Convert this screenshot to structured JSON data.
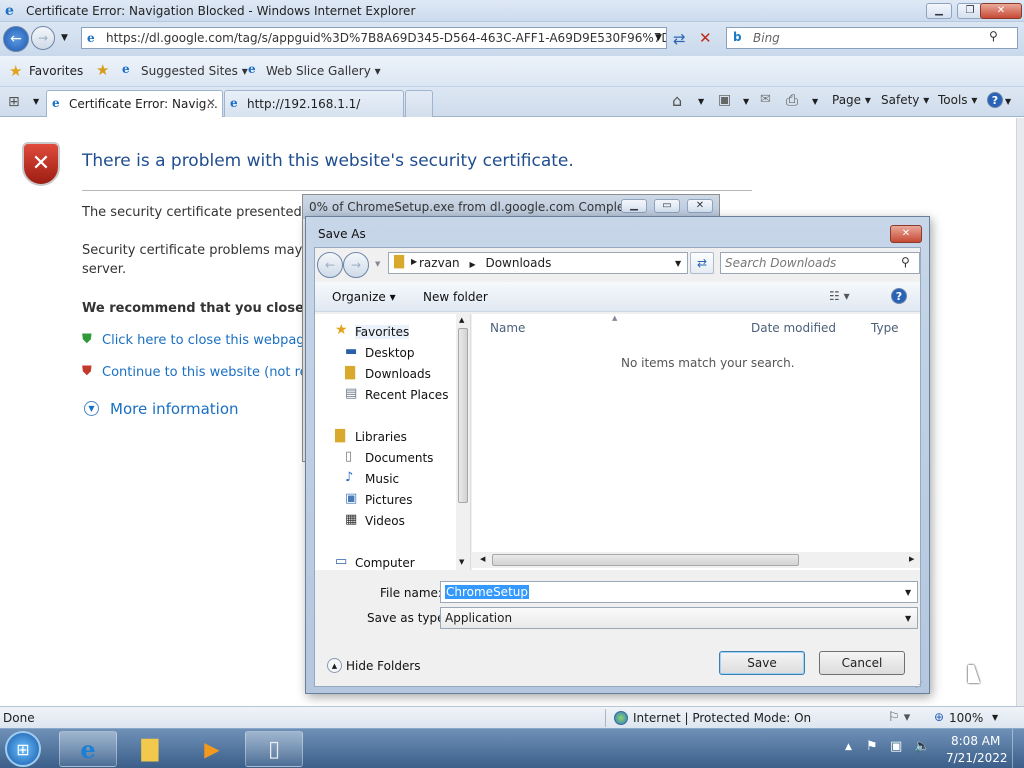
{
  "window": {
    "title": "Certificate Error: Navigation Blocked - Windows Internet Explorer"
  },
  "address": {
    "url": "https://dl.google.com/tag/s/appguid%3D%7B8A69D345-D564-463C-AFF1-A69D9E530F96%7D%26iid%",
    "search_placeholder": "Bing"
  },
  "favbar": {
    "favorites": "Favorites",
    "suggested": "Suggested Sites",
    "webslice": "Web Slice Gallery"
  },
  "tabs": [
    {
      "label": "Certificate Error: Navig..."
    },
    {
      "label": "http://192.168.1.1/"
    }
  ],
  "cmdbar": {
    "page": "Page",
    "safety": "Safety",
    "tools": "Tools"
  },
  "content": {
    "heading": "There is a problem with this website's security certificate.",
    "p1": "The security certificate presented by",
    "p2a": "Security certificate problems may ind",
    "p2b": "server.",
    "recommend": "We recommend that you close th",
    "close_link": "Click here to close this webpage.",
    "continue_link": "Continue to this website (not rec",
    "more_info": "More information"
  },
  "download": {
    "title": "0% of ChromeSetup.exe from dl.google.com Completed"
  },
  "dialog": {
    "title": "Save As",
    "breadcrumb": [
      "razvan",
      "Downloads"
    ],
    "search_placeholder": "Search Downloads",
    "organize": "Organize",
    "new_folder": "New folder",
    "nav_favorites": "Favorites",
    "nav_items": [
      "Desktop",
      "Downloads",
      "Recent Places"
    ],
    "nav_libraries": "Libraries",
    "lib_items": [
      "Documents",
      "Music",
      "Pictures",
      "Videos"
    ],
    "nav_computer": "Computer",
    "columns": {
      "name": "Name",
      "date": "Date modified",
      "type": "Type"
    },
    "empty": "No items match your search.",
    "filename_label": "File name:",
    "filename": "ChromeSetup",
    "savetype_label": "Save as type:",
    "savetype": "Application",
    "hide_folders": "Hide Folders",
    "save": "Save",
    "cancel": "Cancel"
  },
  "status": {
    "text": "Done",
    "zone": "Internet | Protected Mode: On",
    "zoom": "100%"
  },
  "taskbar": {
    "time": "8:08 AM",
    "date": "7/21/2022"
  }
}
